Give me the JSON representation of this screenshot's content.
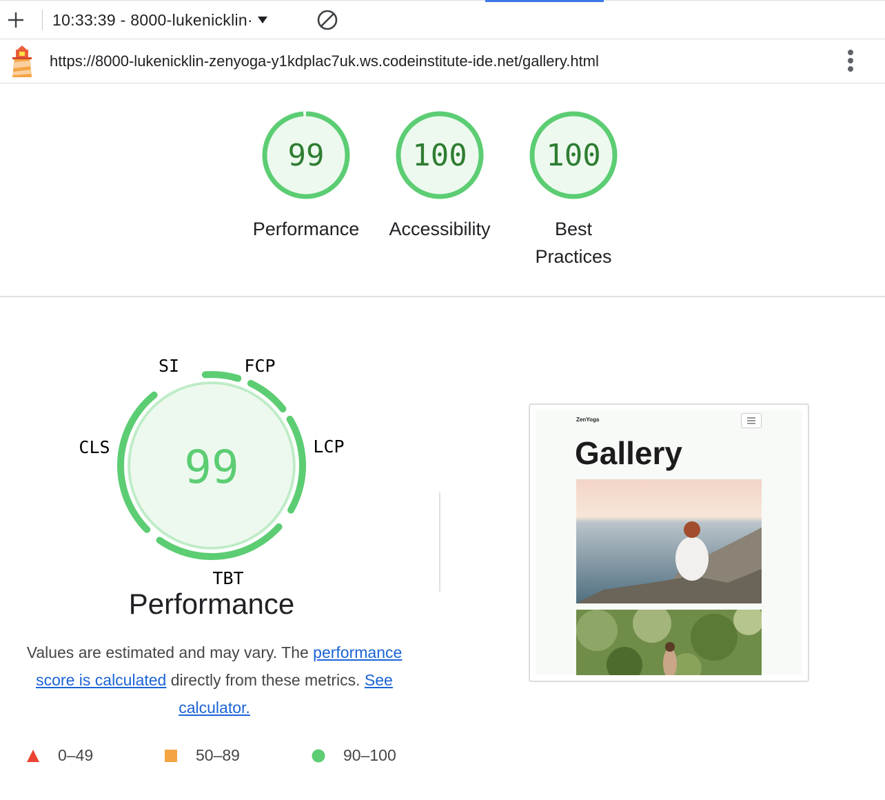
{
  "toolbar": {
    "report_label": "10:33:39 - 8000-lukenicklin·"
  },
  "url": "https://8000-lukenicklin-zenyoga-y1kdplac7uk.ws.codeinstitute-ide.net/gallery.html",
  "gauges": [
    {
      "score": "99",
      "label": "Performance"
    },
    {
      "score": "100",
      "label": "Accessibility"
    },
    {
      "score": "100",
      "label_line1": "Best",
      "label_line2": "Practices"
    }
  ],
  "performance": {
    "score": "99",
    "title": "Performance",
    "metrics": {
      "si": "SI",
      "fcp": "FCP",
      "lcp": "LCP",
      "tbt": "TBT",
      "cls": "CLS"
    },
    "description": {
      "text1": "Values are estimated and may vary. The ",
      "link1": "performance score is calculated",
      "text2": " directly from these metrics. ",
      "link2": "See calculator."
    }
  },
  "legend": [
    {
      "range": "0–49",
      "shape": "triangle",
      "color": "#eb4335"
    },
    {
      "range": "50–89",
      "shape": "square",
      "color": "#f4a443"
    },
    {
      "range": "90–100",
      "shape": "circle",
      "color": "#5ccd73"
    }
  ],
  "thumbnail": {
    "brand": "ZenYoga",
    "heading": "Gallery"
  },
  "colors": {
    "pass_green": "#5ccd73",
    "pass_green_text": "#2e7d32",
    "pass_green_fill": "#edf9ef",
    "link_blue": "#1a63d6"
  }
}
